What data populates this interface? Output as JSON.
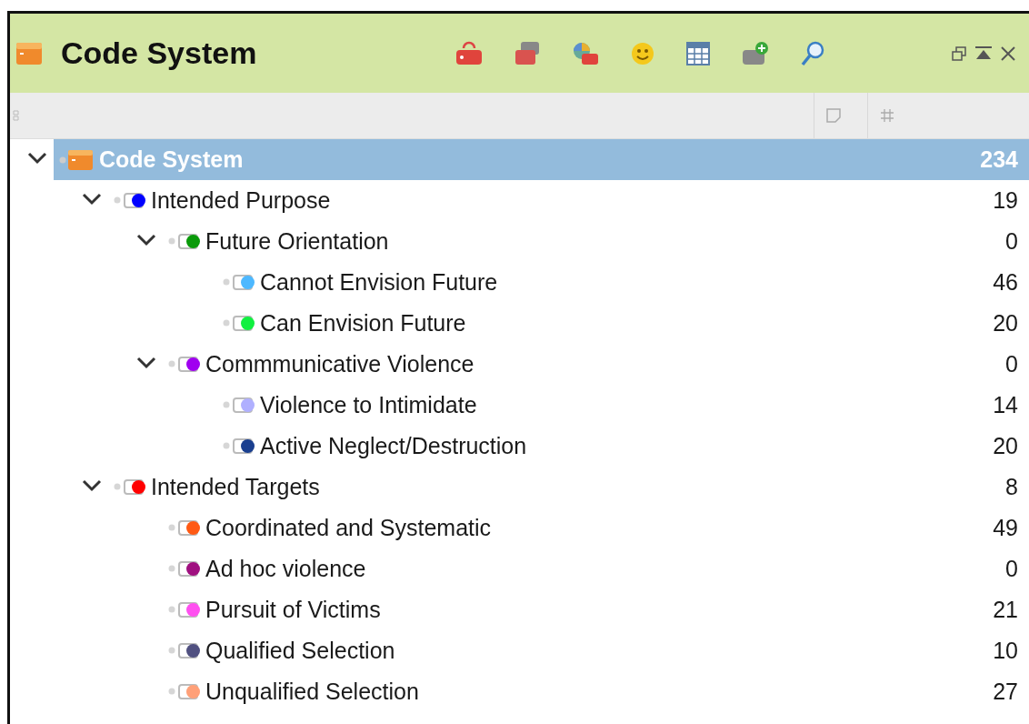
{
  "window": {
    "title": "Code System"
  },
  "tree": {
    "label": "Code System",
    "count": "234",
    "selected": true,
    "expanded": true,
    "children": [
      {
        "label": "Intended Purpose",
        "count": "19",
        "color": "#0000ff",
        "selected": false,
        "expanded": true,
        "children": [
          {
            "label": "Future Orientation",
            "count": "0",
            "color": "#0a9a0a",
            "selected": false,
            "expanded": true,
            "children": [
              {
                "label": "Cannot Envision Future",
                "count": "46",
                "color": "#4db8ff",
                "selected": false
              },
              {
                "label": "Can Envision Future",
                "count": "20",
                "color": "#10f040",
                "selected": false
              }
            ]
          },
          {
            "label": "Commmunicative Violence",
            "count": "0",
            "color": "#a000f0",
            "selected": false,
            "expanded": true,
            "children": [
              {
                "label": "Violence to Intimidate",
                "count": "14",
                "color": "#b0b0ff",
                "selected": false
              },
              {
                "label": "Active Neglect/Destruction",
                "count": "20",
                "color": "#1a3f8f",
                "selected": false
              }
            ]
          }
        ]
      },
      {
        "label": "Intended Targets",
        "count": "8",
        "color": "#ff0000",
        "selected": false,
        "expanded": true,
        "children": [
          {
            "label": "Coordinated and Systematic",
            "count": "49",
            "color": "#ff5a14",
            "selected": false
          },
          {
            "label": "Ad hoc violence",
            "count": "0",
            "color": "#a01080",
            "selected": false
          },
          {
            "label": "Pursuit of Victims",
            "count": "21",
            "color": "#ff50f0",
            "selected": false
          },
          {
            "label": "Qualified Selection",
            "count": "10",
            "color": "#505080",
            "selected": false
          },
          {
            "label": "Unqualified Selection",
            "count": "27",
            "color": "#ffa078",
            "selected": false
          }
        ]
      }
    ]
  }
}
